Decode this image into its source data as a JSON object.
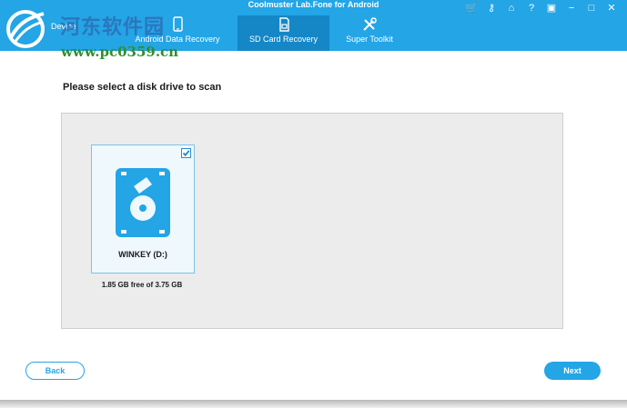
{
  "app": {
    "title": "Coolmuster Lab.Fone for Android"
  },
  "watermark": {
    "text": "河东软件园",
    "url": "www.pc0359.cn"
  },
  "nav": {
    "device_label": "Device",
    "tabs": [
      {
        "label": "Android Data Recovery",
        "icon": "android-phone-icon"
      },
      {
        "label": "SD Card Recovery",
        "icon": "sd-card-icon",
        "active": true
      },
      {
        "label": "Super Toolkit",
        "icon": "tools-icon"
      }
    ]
  },
  "window_controls": [
    {
      "icon": "cart-icon",
      "glyph": "🛒"
    },
    {
      "icon": "key-icon",
      "glyph": "⚷"
    },
    {
      "icon": "home-icon",
      "glyph": "⌂"
    },
    {
      "icon": "help-icon",
      "glyph": "?"
    },
    {
      "icon": "feedback-icon",
      "glyph": "▣"
    },
    {
      "icon": "minimize-icon",
      "glyph": "−"
    },
    {
      "icon": "maximize-icon",
      "glyph": "□"
    },
    {
      "icon": "close-icon",
      "glyph": "✕"
    }
  ],
  "main": {
    "heading": "Please select a disk drive to scan",
    "drives": [
      {
        "name": "WINKEY (D:)",
        "space": "1.85 GB free of 3.75 GB",
        "selected": true
      }
    ]
  },
  "footer": {
    "back_label": "Back",
    "next_label": "Next"
  },
  "colors": {
    "accent": "#23a5e6",
    "active_tab": "#1587c6"
  }
}
